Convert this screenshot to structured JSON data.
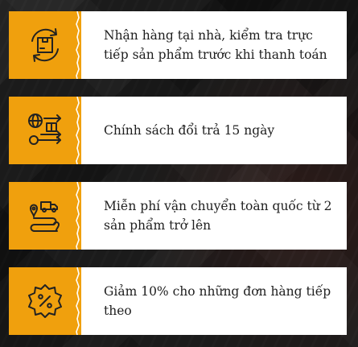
{
  "colors": {
    "accent": "#f0a00d",
    "card_bg": "#ffffff",
    "text": "#1e1e1e"
  },
  "features": [
    {
      "icon": "delivery-box-cycle-icon",
      "text": "Nhận hàng tại nhà, kiểm tra trực tiếp sản phẩm trước khi thanh toán"
    },
    {
      "icon": "exchange-return-icon",
      "text": "Chính sách đổi trả 15 ngày"
    },
    {
      "icon": "shipping-route-icon",
      "text": "Miễn phí vận chuyển toàn quốc từ 2 sản phẩm trở lên"
    },
    {
      "icon": "discount-badge-icon",
      "text": "Giảm 10% cho những đơn hàng tiếp theo"
    }
  ]
}
